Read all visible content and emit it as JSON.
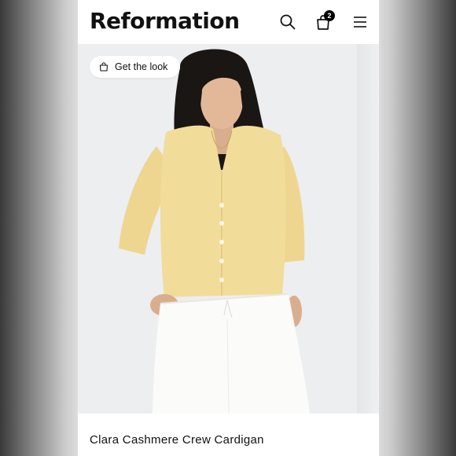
{
  "header": {
    "brand": "Reformation",
    "cart_count": "2",
    "icons": [
      "search-icon",
      "shopping-bag-icon",
      "hamburger-menu-icon"
    ]
  },
  "gallery": {
    "get_the_look_label": "Get the look",
    "photo_subject": "model wearing yellow cardigan and white skirt"
  },
  "product": {
    "name": "Clara Cashmere Crew Cardigan"
  },
  "colors": {
    "cardigan": "#f1dc9a",
    "background": "#eceef0",
    "badge": "#000000"
  }
}
